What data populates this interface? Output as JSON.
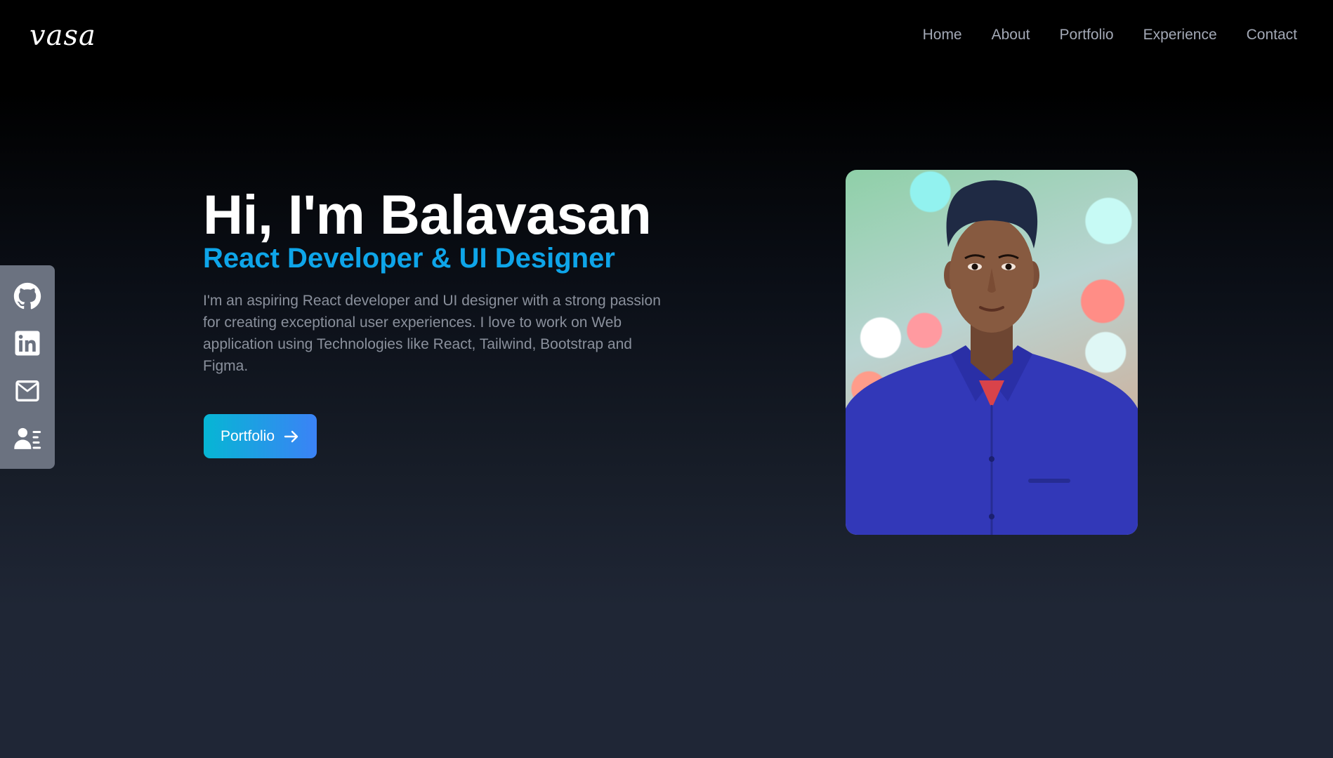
{
  "header": {
    "logo": "vasa",
    "nav": [
      "Home",
      "About",
      "Portfolio",
      "Experience",
      "Contact"
    ]
  },
  "social": {
    "icons": [
      "github-icon",
      "linkedin-icon",
      "mail-icon",
      "resume-icon"
    ]
  },
  "hero": {
    "title": "Hi, I'm Balavasan",
    "subtitle": "React Developer & UI Designer",
    "description": "I'm an aspiring React developer and UI designer with a strong passion for creating exceptional user experiences. I love to work on Web application using Technologies like React, Tailwind, Bootstrap and Figma.",
    "cta_label": "Portfolio"
  },
  "colors": {
    "accent": "#0ea5e9",
    "button_gradient_start": "#06b6d4",
    "button_gradient_end": "#3b82f6",
    "sidebar": "#6b7280"
  }
}
